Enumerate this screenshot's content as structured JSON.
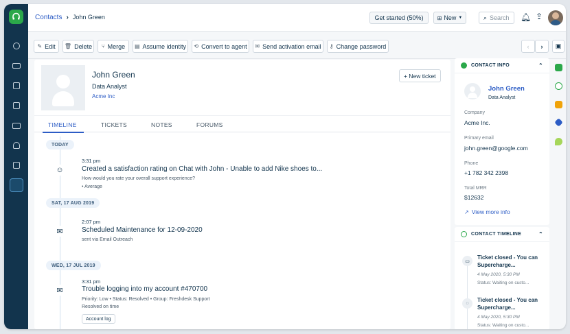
{
  "breadcrumb": {
    "parent": "Contacts",
    "separator": "›",
    "current": "John Green"
  },
  "header": {
    "get_started": "Get started (50%)",
    "new_label": "New",
    "search_placeholder": "Search"
  },
  "toolbar": {
    "edit": "Edit",
    "delete": "Delete",
    "merge": "Merge",
    "assume_identity": "Assume identity",
    "convert_to_agent": "Convert to agent",
    "send_activation_email": "Send activation email",
    "change_password": "Change password"
  },
  "profile": {
    "name": "John Green",
    "title": "Data Analyst",
    "company": "Acme Inc",
    "new_ticket": "+ New ticket"
  },
  "tabs": [
    "TIMELINE",
    "TICKETS",
    "NOTES",
    "FORUMS"
  ],
  "timeline": {
    "dates": [
      "TODAY",
      "SAT, 17 AUG 2019",
      "WED, 17 JUL 2019"
    ],
    "events": [
      {
        "icon": "smiley-icon",
        "time": "3:31 pm",
        "title": "Created a satisfaction rating on Chat with John - Unable to add Nike shoes to...",
        "sub1": "How would you rate your overall support experience?",
        "sub2": "• Average"
      },
      {
        "icon": "mail-icon",
        "time": "2:07 pm",
        "title": "Scheduled Maintenance for 12-09-2020",
        "sub1": "sent via Email Outreach"
      },
      {
        "icon": "mail-icon",
        "time": "3:31 pm",
        "title": "Trouble logging into my account #470700",
        "sub1": "Priority: Low  •  Status: Resolved  •  Group: Freshdesk Support",
        "sub2": "Resolved on time",
        "tag": "Account log"
      }
    ]
  },
  "contact_info": {
    "header": "CONTACT INFO",
    "name": "John Green",
    "title": "Data Analyst",
    "company_label": "Company",
    "company": "Acme Inc.",
    "email_label": "Primary email",
    "email": "john.green@google.com",
    "phone_label": "Phone",
    "phone": "+1 782 342 2398",
    "mrr_label": "Total MRR",
    "mrr": "$12632",
    "view_more": "View more info"
  },
  "contact_timeline": {
    "header": "CONTACT TIMELINE",
    "items": [
      {
        "title1": "Ticket closed - You can",
        "title2": "Supercharge...",
        "date": "4 May 2020, 5:30 PM",
        "status": "Status: Waiting on custo..."
      },
      {
        "title1": "Ticket closed - You can",
        "title2": "Supercharge...",
        "date": "4 May 2020, 5:30 PM",
        "status": "Status: Waiting on custo..."
      }
    ]
  },
  "colors": {
    "rail": "#12344d",
    "brand_green": "#2ba84a",
    "link_blue": "#2c5cc5"
  }
}
